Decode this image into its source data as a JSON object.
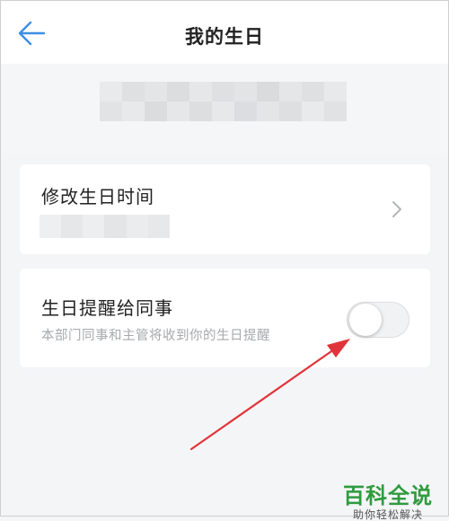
{
  "header": {
    "title": "我的生日",
    "back_icon": "arrow-left-icon",
    "accent_color": "#3d8ee6"
  },
  "profile": {
    "name_redacted": true
  },
  "birthday_row": {
    "label": "修改生日时间",
    "value_redacted": true,
    "chevron_icon": "chevron-right-icon"
  },
  "remind_row": {
    "label": "生日提醒给同事",
    "description": "本部门同事和主管将收到你的生日提醒",
    "toggle_on": false
  },
  "annotation": {
    "arrow_color": "#e0343a"
  },
  "watermark": {
    "title": "百科全说",
    "subtitle": "助你轻松解决",
    "color": "#2f9b3e"
  }
}
